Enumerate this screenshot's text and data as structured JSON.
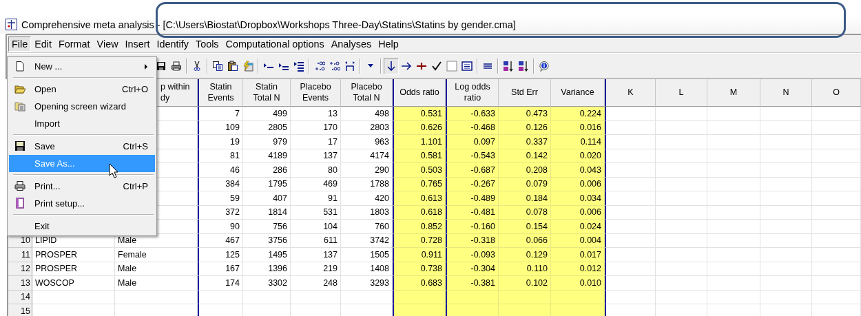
{
  "window": {
    "title": "Comprehensive meta analysis - [C:\\Users\\Biostat\\Dropbox\\Workshops Three-Day\\Statins\\Statins by gender.cma]"
  },
  "menubar": [
    {
      "label": "File",
      "selected": true
    },
    {
      "label": "Edit",
      "selected": false
    },
    {
      "label": "Format",
      "selected": false
    },
    {
      "label": "View",
      "selected": false
    },
    {
      "label": "Insert",
      "selected": false
    },
    {
      "label": "Identify",
      "selected": false
    },
    {
      "label": "Tools",
      "selected": false
    },
    {
      "label": "Computational options",
      "selected": false
    },
    {
      "label": "Analyses",
      "selected": false
    },
    {
      "label": "Help",
      "selected": false
    }
  ],
  "file_menu": [
    {
      "kind": "item",
      "label": "New ...",
      "submenu": true,
      "selected": false
    },
    {
      "kind": "separator"
    },
    {
      "kind": "item",
      "label": "Open",
      "shortcut": "Ctrl+O",
      "selected": false
    },
    {
      "kind": "item",
      "label": "Opening screen wizard",
      "selected": false
    },
    {
      "kind": "item",
      "label": "Import",
      "selected": false
    },
    {
      "kind": "separator"
    },
    {
      "kind": "item",
      "label": "Save",
      "shortcut": "Ctrl+S",
      "selected": false
    },
    {
      "kind": "item",
      "label": "Save As...",
      "selected": true
    },
    {
      "kind": "separator"
    },
    {
      "kind": "item",
      "label": "Print...",
      "shortcut": "Ctrl+P",
      "selected": false
    },
    {
      "kind": "item",
      "label": "Print setup...",
      "selected": false
    },
    {
      "kind": "separator"
    },
    {
      "kind": "item",
      "label": "Exit",
      "selected": false
    }
  ],
  "toolbar": [
    {
      "pressed": false
    },
    {
      "pressed": false
    },
    {
      "pressed": false
    },
    {
      "pressed": false
    },
    {
      "pressed": false
    },
    {
      "pressed": false
    },
    {
      "pressed": false
    },
    {
      "pressed": false
    },
    {
      "pressed": false
    },
    {
      "pressed": false
    },
    {
      "pressed": false
    },
    {
      "pressed": false
    },
    {
      "pressed": false
    },
    {
      "pressed": true
    },
    {
      "pressed": false
    },
    {
      "pressed": false
    },
    {
      "pressed": false
    },
    {
      "pressed": false
    },
    {
      "pressed": false
    },
    {
      "pressed": false
    },
    {
      "pressed": false
    },
    {
      "pressed": false
    },
    {
      "pressed": false
    }
  ],
  "table": {
    "columns": [
      {
        "label": "p within\ndy",
        "kind": "text",
        "group_start": false
      },
      {
        "label": "Statin\nEvents",
        "kind": "input",
        "group_start": true
      },
      {
        "label": "Statin\nTotal N",
        "kind": "input",
        "group_start": false
      },
      {
        "label": "Placebo\nEvents",
        "kind": "input",
        "group_start": false
      },
      {
        "label": "Placebo\nTotal N",
        "kind": "input",
        "group_start": false
      },
      {
        "label": "Odds ratio",
        "kind": "computed",
        "group_start": true
      },
      {
        "label": "Log odds\nratio",
        "kind": "computed",
        "group_start": true
      },
      {
        "label": "Std Err",
        "kind": "computed",
        "group_start": false
      },
      {
        "label": "Variance",
        "kind": "computed",
        "group_start": false
      },
      {
        "label": "K",
        "kind": "spare",
        "group_start": true
      },
      {
        "label": "L",
        "kind": "spare",
        "group_start": false
      },
      {
        "label": "M",
        "kind": "spare",
        "group_start": false
      },
      {
        "label": "N",
        "kind": "spare",
        "group_start": false
      },
      {
        "label": "O",
        "kind": "spare",
        "group_start": false
      }
    ],
    "rows": [
      {
        "values": [
          "7",
          "499",
          "13",
          "498",
          "0.531",
          "-0.633",
          "0.473",
          "0.224"
        ]
      },
      {
        "values": [
          "109",
          "2805",
          "170",
          "2803",
          "0.626",
          "-0.468",
          "0.126",
          "0.016"
        ]
      },
      {
        "values": [
          "19",
          "979",
          "17",
          "963",
          "1.101",
          "0.097",
          "0.337",
          "0.114"
        ]
      },
      {
        "values": [
          "81",
          "4189",
          "137",
          "4174",
          "0.581",
          "-0.543",
          "0.142",
          "0.020"
        ]
      },
      {
        "values": [
          "46",
          "286",
          "80",
          "290",
          "0.503",
          "-0.687",
          "0.208",
          "0.043"
        ]
      },
      {
        "values": [
          "384",
          "1795",
          "469",
          "1788",
          "0.765",
          "-0.267",
          "0.079",
          "0.006"
        ]
      },
      {
        "values": [
          "59",
          "407",
          "91",
          "420",
          "0.613",
          "-0.489",
          "0.184",
          "0.034"
        ]
      },
      {
        "values": [
          "372",
          "1814",
          "531",
          "1803",
          "0.618",
          "-0.481",
          "0.078",
          "0.006"
        ]
      },
      {
        "values": [
          "90",
          "756",
          "104",
          "760",
          "0.852",
          "-0.160",
          "0.154",
          "0.024"
        ]
      },
      {
        "number": "10",
        "study": "LIPID",
        "subgroup": "Male",
        "values": [
          "467",
          "3756",
          "611",
          "3742",
          "0.728",
          "-0.318",
          "0.066",
          "0.004"
        ]
      },
      {
        "number": "11",
        "study": "PROSPER",
        "subgroup": "Female",
        "values": [
          "125",
          "1495",
          "137",
          "1505",
          "0.911",
          "-0.093",
          "0.129",
          "0.017"
        ]
      },
      {
        "number": "12",
        "study": "PROSPER",
        "subgroup": "Male",
        "values": [
          "167",
          "1396",
          "219",
          "1408",
          "0.738",
          "-0.304",
          "0.110",
          "0.012"
        ]
      },
      {
        "number": "13",
        "study": "WOSCOP",
        "subgroup": "Male",
        "values": [
          "174",
          "3302",
          "248",
          "3293",
          "0.683",
          "-0.381",
          "0.102",
          "0.010"
        ]
      },
      {
        "number": "14"
      },
      {
        "number": "15"
      }
    ]
  }
}
